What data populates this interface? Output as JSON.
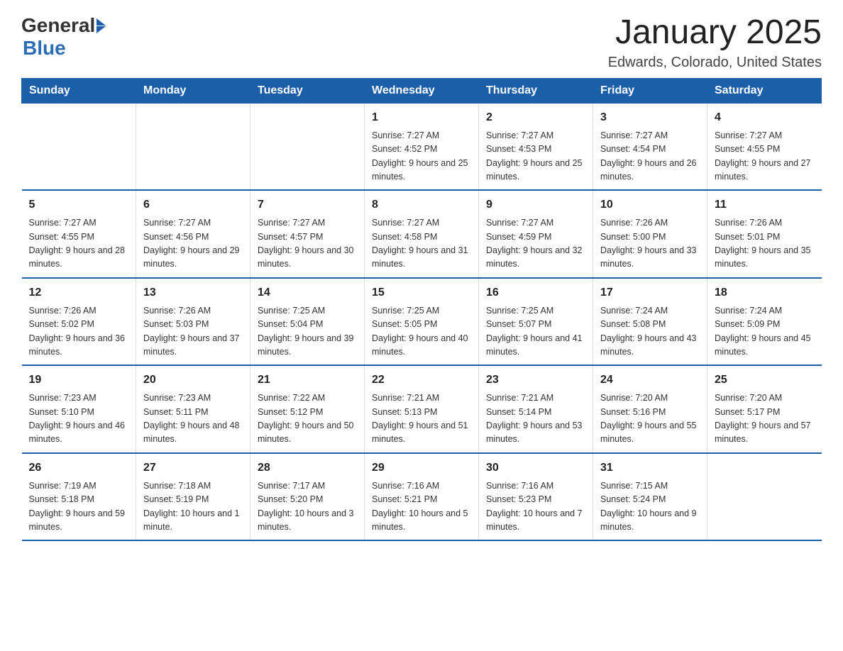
{
  "header": {
    "logo_general": "General",
    "logo_blue": "Blue",
    "title": "January 2025",
    "subtitle": "Edwards, Colorado, United States"
  },
  "days_of_week": [
    "Sunday",
    "Monday",
    "Tuesday",
    "Wednesday",
    "Thursday",
    "Friday",
    "Saturday"
  ],
  "weeks": [
    [
      {
        "day": "",
        "info": ""
      },
      {
        "day": "",
        "info": ""
      },
      {
        "day": "",
        "info": ""
      },
      {
        "day": "1",
        "info": "Sunrise: 7:27 AM\nSunset: 4:52 PM\nDaylight: 9 hours\nand 25 minutes."
      },
      {
        "day": "2",
        "info": "Sunrise: 7:27 AM\nSunset: 4:53 PM\nDaylight: 9 hours\nand 25 minutes."
      },
      {
        "day": "3",
        "info": "Sunrise: 7:27 AM\nSunset: 4:54 PM\nDaylight: 9 hours\nand 26 minutes."
      },
      {
        "day": "4",
        "info": "Sunrise: 7:27 AM\nSunset: 4:55 PM\nDaylight: 9 hours\nand 27 minutes."
      }
    ],
    [
      {
        "day": "5",
        "info": "Sunrise: 7:27 AM\nSunset: 4:55 PM\nDaylight: 9 hours\nand 28 minutes."
      },
      {
        "day": "6",
        "info": "Sunrise: 7:27 AM\nSunset: 4:56 PM\nDaylight: 9 hours\nand 29 minutes."
      },
      {
        "day": "7",
        "info": "Sunrise: 7:27 AM\nSunset: 4:57 PM\nDaylight: 9 hours\nand 30 minutes."
      },
      {
        "day": "8",
        "info": "Sunrise: 7:27 AM\nSunset: 4:58 PM\nDaylight: 9 hours\nand 31 minutes."
      },
      {
        "day": "9",
        "info": "Sunrise: 7:27 AM\nSunset: 4:59 PM\nDaylight: 9 hours\nand 32 minutes."
      },
      {
        "day": "10",
        "info": "Sunrise: 7:26 AM\nSunset: 5:00 PM\nDaylight: 9 hours\nand 33 minutes."
      },
      {
        "day": "11",
        "info": "Sunrise: 7:26 AM\nSunset: 5:01 PM\nDaylight: 9 hours\nand 35 minutes."
      }
    ],
    [
      {
        "day": "12",
        "info": "Sunrise: 7:26 AM\nSunset: 5:02 PM\nDaylight: 9 hours\nand 36 minutes."
      },
      {
        "day": "13",
        "info": "Sunrise: 7:26 AM\nSunset: 5:03 PM\nDaylight: 9 hours\nand 37 minutes."
      },
      {
        "day": "14",
        "info": "Sunrise: 7:25 AM\nSunset: 5:04 PM\nDaylight: 9 hours\nand 39 minutes."
      },
      {
        "day": "15",
        "info": "Sunrise: 7:25 AM\nSunset: 5:05 PM\nDaylight: 9 hours\nand 40 minutes."
      },
      {
        "day": "16",
        "info": "Sunrise: 7:25 AM\nSunset: 5:07 PM\nDaylight: 9 hours\nand 41 minutes."
      },
      {
        "day": "17",
        "info": "Sunrise: 7:24 AM\nSunset: 5:08 PM\nDaylight: 9 hours\nand 43 minutes."
      },
      {
        "day": "18",
        "info": "Sunrise: 7:24 AM\nSunset: 5:09 PM\nDaylight: 9 hours\nand 45 minutes."
      }
    ],
    [
      {
        "day": "19",
        "info": "Sunrise: 7:23 AM\nSunset: 5:10 PM\nDaylight: 9 hours\nand 46 minutes."
      },
      {
        "day": "20",
        "info": "Sunrise: 7:23 AM\nSunset: 5:11 PM\nDaylight: 9 hours\nand 48 minutes."
      },
      {
        "day": "21",
        "info": "Sunrise: 7:22 AM\nSunset: 5:12 PM\nDaylight: 9 hours\nand 50 minutes."
      },
      {
        "day": "22",
        "info": "Sunrise: 7:21 AM\nSunset: 5:13 PM\nDaylight: 9 hours\nand 51 minutes."
      },
      {
        "day": "23",
        "info": "Sunrise: 7:21 AM\nSunset: 5:14 PM\nDaylight: 9 hours\nand 53 minutes."
      },
      {
        "day": "24",
        "info": "Sunrise: 7:20 AM\nSunset: 5:16 PM\nDaylight: 9 hours\nand 55 minutes."
      },
      {
        "day": "25",
        "info": "Sunrise: 7:20 AM\nSunset: 5:17 PM\nDaylight: 9 hours\nand 57 minutes."
      }
    ],
    [
      {
        "day": "26",
        "info": "Sunrise: 7:19 AM\nSunset: 5:18 PM\nDaylight: 9 hours\nand 59 minutes."
      },
      {
        "day": "27",
        "info": "Sunrise: 7:18 AM\nSunset: 5:19 PM\nDaylight: 10 hours\nand 1 minute."
      },
      {
        "day": "28",
        "info": "Sunrise: 7:17 AM\nSunset: 5:20 PM\nDaylight: 10 hours\nand 3 minutes."
      },
      {
        "day": "29",
        "info": "Sunrise: 7:16 AM\nSunset: 5:21 PM\nDaylight: 10 hours\nand 5 minutes."
      },
      {
        "day": "30",
        "info": "Sunrise: 7:16 AM\nSunset: 5:23 PM\nDaylight: 10 hours\nand 7 minutes."
      },
      {
        "day": "31",
        "info": "Sunrise: 7:15 AM\nSunset: 5:24 PM\nDaylight: 10 hours\nand 9 minutes."
      },
      {
        "day": "",
        "info": ""
      }
    ]
  ]
}
